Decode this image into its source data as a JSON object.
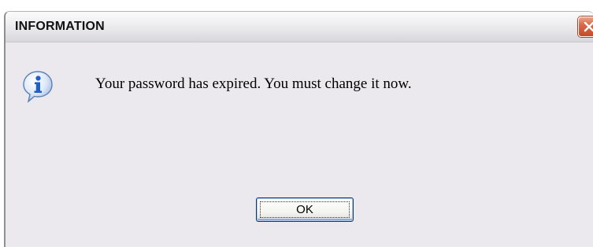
{
  "dialog": {
    "title": "INFORMATION",
    "message": "Your password has expired. You must change it now.",
    "icon": "information-icon",
    "close_icon": "close-icon",
    "ok_label": "OK"
  },
  "colors": {
    "close_button": "#d9694a",
    "info_icon_blue": "#1f5fc6",
    "ok_border": "#003c74",
    "background": "#ebe9ed"
  }
}
